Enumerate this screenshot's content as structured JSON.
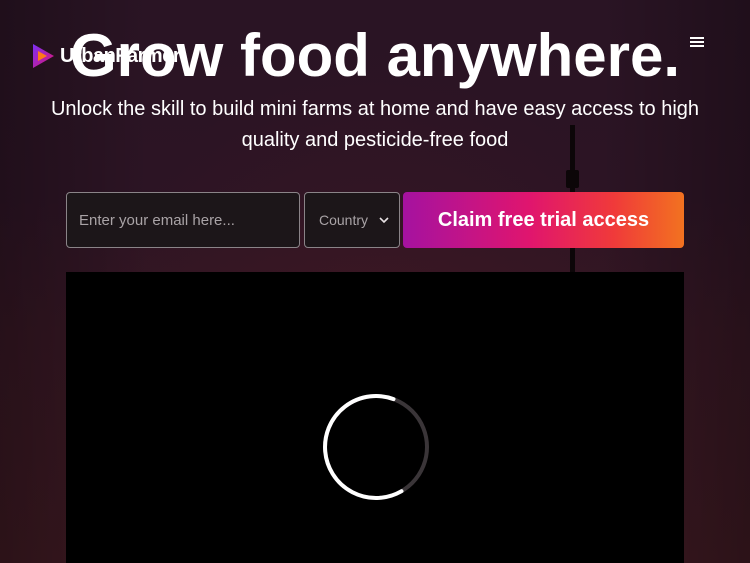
{
  "header": {
    "brand_name": "UrbanFarmer",
    "logo_icon": "play-triangle-logo-icon",
    "menu_icon": "hamburger-menu-icon"
  },
  "hero": {
    "headline": "Grow food anywhere.",
    "subtitle": "Unlock the skill to build mini farms at home and have easy access to high quality and pesticide-free food"
  },
  "signup_form": {
    "email_placeholder": "Enter your email here...",
    "email_value": "",
    "country_selected": "Country",
    "cta_label": "Claim free trial access"
  },
  "video": {
    "state": "loading",
    "loading_icon": "spinner-icon"
  },
  "colors": {
    "cta_gradient_start": "#a512a0",
    "cta_gradient_mid": "#e0156e",
    "cta_gradient_end": "#f27220",
    "background": "#2c1424",
    "logo_purple": "#7b2ff7",
    "logo_orange": "#ff7a1a"
  }
}
